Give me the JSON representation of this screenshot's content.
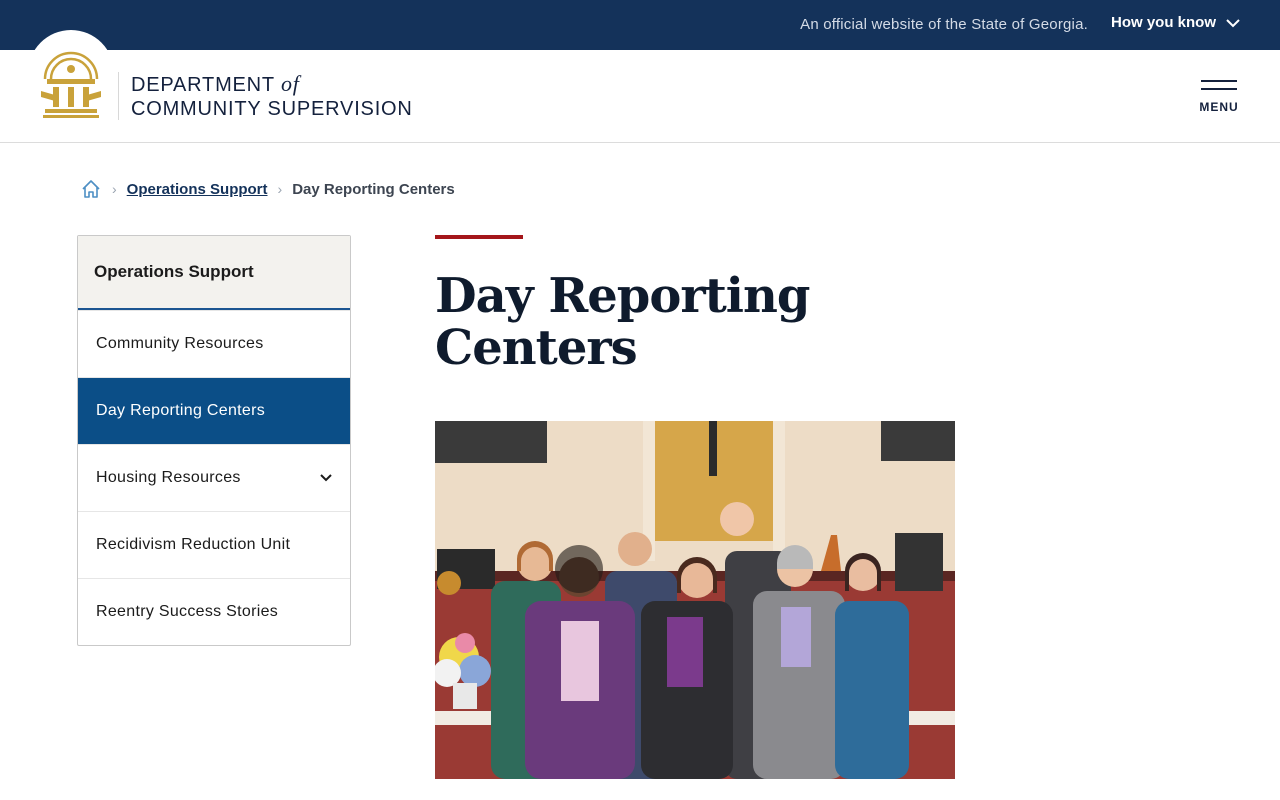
{
  "gov_bar": {
    "official_text": "An official website of the State of Georgia.",
    "how_you_know": "How you know"
  },
  "header": {
    "brand_line1": "DEPARTMENT",
    "brand_of": "of",
    "brand_line2": "COMMUNITY SUPERVISION",
    "menu_label": "MENU",
    "seal_icon": "georgia-seal-icon"
  },
  "breadcrumb": {
    "home_icon": "home-icon",
    "items": [
      {
        "label": "Operations Support",
        "link": true
      },
      {
        "label": "Day Reporting Centers",
        "link": false
      }
    ]
  },
  "sidenav": {
    "heading": "Operations Support",
    "items": [
      {
        "label": "Community Resources",
        "active": false,
        "expandable": false
      },
      {
        "label": "Day Reporting Centers",
        "active": true,
        "expandable": false
      },
      {
        "label": "Housing Resources",
        "active": false,
        "expandable": true
      },
      {
        "label": "Recidivism Reduction Unit",
        "active": false,
        "expandable": false
      },
      {
        "label": "Reentry Success Stories",
        "active": false,
        "expandable": false
      }
    ]
  },
  "main": {
    "title": "Day Reporting Centers"
  },
  "colors": {
    "gov_bar": "#14325a",
    "brand_text": "#14213d",
    "active_nav": "#0b4e87",
    "accent_line": "#a4161a",
    "gold": "#c9a23a"
  }
}
